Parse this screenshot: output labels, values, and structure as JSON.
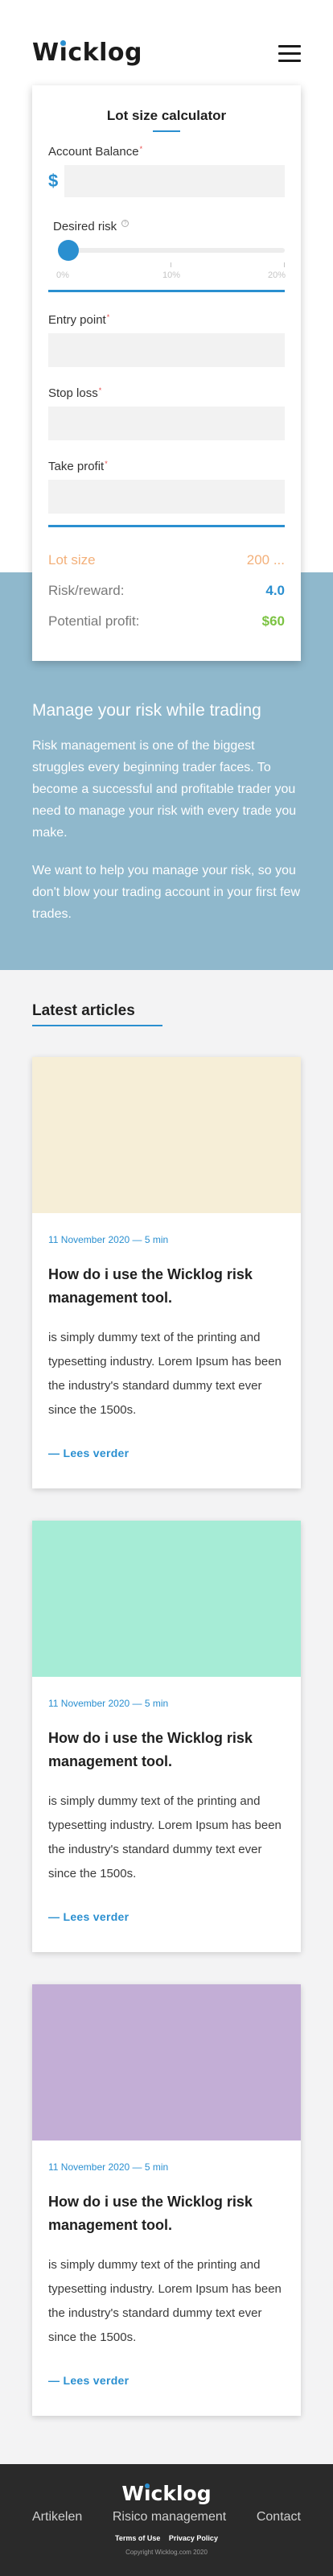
{
  "header": {
    "logo_prefix": "W",
    "logo_i": "i",
    "logo_suffix": "cklog",
    "menu_icon": "hamburger-menu-icon"
  },
  "calculator": {
    "title": "Lot size calculator",
    "account_balance_label": "Account Balance",
    "required_mark": "*",
    "currency_symbol": "$",
    "account_balance_value": "",
    "desired_risk_label": "Desired risk",
    "info_mark": "?",
    "risk_value_percent": 0,
    "risk_ticks": [
      "0%",
      "10%",
      "20%"
    ],
    "entry_point_label": "Entry point",
    "entry_point_value": "",
    "stop_loss_label": "Stop loss",
    "stop_loss_value": "",
    "take_profit_label": "Take profit",
    "take_profit_value": "",
    "results": {
      "lot_size_label": "Lot size",
      "lot_size_value": "200 ...",
      "risk_reward_label": "Risk/reward:",
      "risk_reward_value": "4.0",
      "potential_profit_label": "Potential profit:",
      "potential_profit_value": "$60"
    }
  },
  "risk_section": {
    "title": "Manage your risk while trading",
    "paragraphs": [
      "Risk management is one of the biggest struggles every beginning trader faces. To become a successful and profitable trader you need to manage your risk with every trade you make.",
      "We want to help you manage your risk, so you don't blow your trading account in your first few trades."
    ]
  },
  "articles": {
    "title": "Latest articles",
    "items": [
      {
        "image_color": "#f6eed7",
        "meta": "11 November 2020 — 5 min",
        "title": "How do i use the Wicklog risk management tool.",
        "text": "is simply dummy text of the printing and typesetting industry.  Lorem Ipsum has been the  industry's standard dummy text  ever since the 1500s.",
        "link": "— Lees verder"
      },
      {
        "image_color": "#a6ecd6",
        "meta": "11 November 2020 — 5 min",
        "title": "How do i use the Wicklog risk management tool.",
        "text": "is simply dummy text of the printing and typesetting industry.  Lorem Ipsum has been the  industry's standard dummy text  ever since the 1500s.",
        "link": "— Lees verder"
      },
      {
        "image_color": "#c3aed6",
        "meta": "11 November 2020 — 5 min",
        "title": "How do i use the Wicklog risk management tool.",
        "text": "is simply dummy text of the printing and typesetting industry.  Lorem Ipsum has been the  industry's standard dummy text  ever since the 1500s.",
        "link": "— Lees verder"
      }
    ]
  },
  "footer": {
    "logo_prefix": "W",
    "logo_i": "i",
    "logo_suffix": "cklog",
    "nav": [
      "Artikelen",
      "Risico management",
      "Contact"
    ],
    "terms": "Terms of Use",
    "privacy": "Privacy Policy",
    "copyright": "Copyright Wicklog.com 2020"
  },
  "colors": {
    "accent": "#2a8fd0",
    "risk_section_bg": "#8fb8cc",
    "lot_size": "#f3b07a",
    "profit": "#7cc343",
    "footer_bg": "#2a2a2a"
  }
}
